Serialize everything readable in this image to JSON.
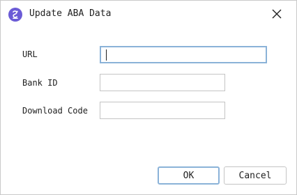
{
  "window": {
    "title": "Update ABA Data",
    "app_icon": "app-logo-icon",
    "close_icon": "close-icon"
  },
  "form": {
    "url_label": "URL",
    "url_value": "",
    "bank_id_label": "Bank ID",
    "bank_id_value": "",
    "download_code_label": "Download Code",
    "download_code_value": ""
  },
  "buttons": {
    "ok_label": "OK",
    "cancel_label": "Cancel"
  },
  "colors": {
    "accent_focus": "#8ab2d8",
    "app_icon": "#6b5bd6",
    "border": "#c4c4c4"
  }
}
